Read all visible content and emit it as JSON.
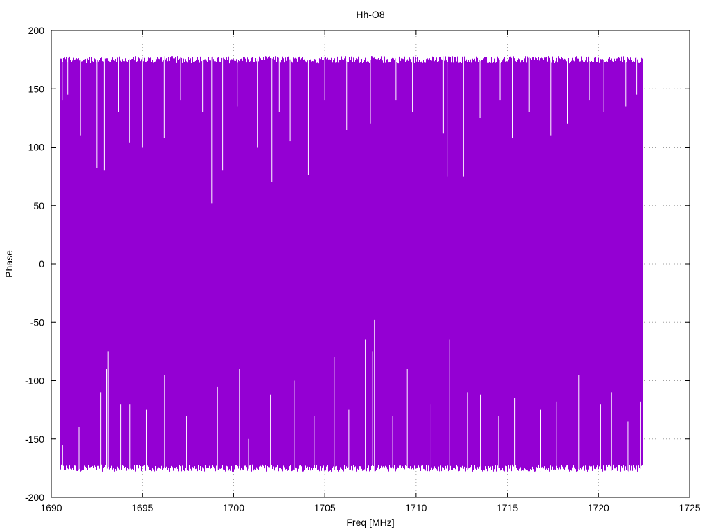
{
  "chart_data": {
    "type": "line",
    "title": "Hh-O8",
    "xlabel": "Freq [MHz]",
    "ylabel": "Phase",
    "xlim": [
      1690,
      1725
    ],
    "ylim": [
      -200,
      200
    ],
    "x_ticks": [
      1690,
      1695,
      1700,
      1705,
      1710,
      1715,
      1720,
      1725
    ],
    "y_ticks": [
      -200,
      -150,
      -100,
      -50,
      0,
      50,
      100,
      150,
      200
    ],
    "grid": true,
    "series_color": "#9400d3",
    "data_x_range": [
      1690.5,
      1722.4
    ],
    "band": {
      "typical_max": [
        172,
        178
      ],
      "typical_min": [
        -178,
        -172
      ]
    },
    "upper_dips": [
      [
        1690.6,
        140
      ],
      [
        1690.9,
        145
      ],
      [
        1691.6,
        110
      ],
      [
        1692.5,
        82
      ],
      [
        1692.9,
        80
      ],
      [
        1693.7,
        130
      ],
      [
        1694.3,
        104
      ],
      [
        1695.0,
        100
      ],
      [
        1696.2,
        108
      ],
      [
        1697.1,
        140
      ],
      [
        1698.3,
        130
      ],
      [
        1698.8,
        52
      ],
      [
        1699.4,
        80
      ],
      [
        1700.2,
        135
      ],
      [
        1701.3,
        100
      ],
      [
        1702.1,
        70
      ],
      [
        1702.5,
        130
      ],
      [
        1703.1,
        105
      ],
      [
        1704.1,
        76
      ],
      [
        1705.0,
        140
      ],
      [
        1706.2,
        115
      ],
      [
        1707.5,
        120
      ],
      [
        1708.9,
        140
      ],
      [
        1709.8,
        130
      ],
      [
        1711.5,
        112
      ],
      [
        1711.7,
        75
      ],
      [
        1712.6,
        75
      ],
      [
        1713.5,
        125
      ],
      [
        1714.6,
        140
      ],
      [
        1715.3,
        108
      ],
      [
        1716.2,
        130
      ],
      [
        1717.4,
        110
      ],
      [
        1718.3,
        120
      ],
      [
        1719.5,
        140
      ],
      [
        1720.3,
        130
      ],
      [
        1721.5,
        135
      ],
      [
        1722.1,
        145
      ]
    ],
    "lower_spikes": [
      [
        1690.6,
        -155
      ],
      [
        1691.5,
        -140
      ],
      [
        1692.7,
        -110
      ],
      [
        1693.0,
        -90
      ],
      [
        1693.1,
        -75
      ],
      [
        1693.8,
        -120
      ],
      [
        1694.3,
        -120
      ],
      [
        1695.2,
        -125
      ],
      [
        1696.2,
        -95
      ],
      [
        1697.4,
        -130
      ],
      [
        1698.2,
        -140
      ],
      [
        1699.1,
        -105
      ],
      [
        1700.3,
        -90
      ],
      [
        1700.8,
        -150
      ],
      [
        1702.0,
        -112
      ],
      [
        1703.3,
        -100
      ],
      [
        1704.4,
        -130
      ],
      [
        1705.5,
        -80
      ],
      [
        1706.3,
        -125
      ],
      [
        1707.2,
        -65
      ],
      [
        1707.6,
        -75
      ],
      [
        1707.7,
        -48
      ],
      [
        1708.7,
        -130
      ],
      [
        1709.5,
        -90
      ],
      [
        1710.8,
        -120
      ],
      [
        1711.8,
        -65
      ],
      [
        1712.8,
        -110
      ],
      [
        1713.5,
        -112
      ],
      [
        1714.5,
        -130
      ],
      [
        1715.4,
        -115
      ],
      [
        1716.8,
        -125
      ],
      [
        1717.7,
        -118
      ],
      [
        1718.9,
        -95
      ],
      [
        1720.1,
        -120
      ],
      [
        1720.7,
        -110
      ],
      [
        1721.6,
        -135
      ],
      [
        1722.3,
        -118
      ]
    ]
  }
}
